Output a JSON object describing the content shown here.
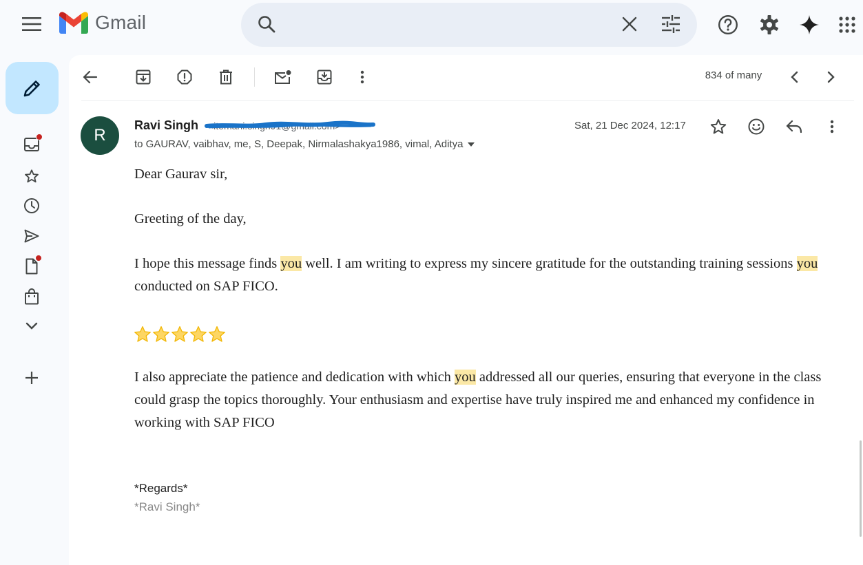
{
  "app": {
    "logo_text": "Gmail"
  },
  "search": {
    "placeholder": "",
    "value": ""
  },
  "toolbar": {
    "counter": "834 of many"
  },
  "email": {
    "avatar_letter": "R",
    "sender_name": "Ravi Singh",
    "sender_email": "<itemani.singh91@gmail.com>",
    "recipients": "to GAURAV, vaibhav, me, S, Deepak, Nirmalashakya1986, vimal, Aditya",
    "date": "Sat, 21 Dec 2024, 12:17",
    "body": {
      "greeting": "Dear Gaurav sir,",
      "greeting2": "Greeting of the day,",
      "p1_a": "I hope this message finds ",
      "p1_b": " well. I am writing to express my sincere gratitude for the outstanding training sessions ",
      "p1_c": " conducted on SAP FICO.",
      "highlight_word": "you",
      "star_rating": 5,
      "p2_a": "I also appreciate the patience and dedication with which ",
      "p2_b": " addressed all our queries, ensuring that everyone in the class could grasp the topics thoroughly. Your enthusiasm and expertise have truly inspired me and enhanced my confidence in working with SAP FICO",
      "regards": "*Regards*",
      "signature": "*Ravi Singh*"
    }
  },
  "colors": {
    "compose_bg": "#c2e7ff",
    "avatar_bg": "#1b4e3f",
    "highlight": "#fbe8a6",
    "search_bg": "#e9eef6",
    "badge": "#c5221f",
    "scribble": "#1a73c8"
  },
  "icons": {
    "top_bar": [
      "menu-icon",
      "gmail-logo",
      "search-icon",
      "close-icon",
      "tune-icon",
      "help-icon",
      "gear-icon",
      "gemini-sparkle-icon",
      "apps-grid-icon"
    ],
    "rail": [
      "pencil-icon",
      "inbox-icon",
      "star-icon",
      "clock-icon",
      "send-icon",
      "draft-icon",
      "shopping-bag-icon",
      "chevron-down-icon",
      "plus-icon"
    ],
    "toolbar": [
      "back-arrow-icon",
      "archive-icon",
      "report-spam-icon",
      "trash-icon",
      "mark-unread-icon",
      "move-to-icon",
      "more-vert-icon",
      "chevron-left-icon",
      "chevron-right-icon"
    ],
    "email_header": [
      "star-outline-icon",
      "emoji-icon",
      "reply-icon",
      "more-vert-icon"
    ]
  }
}
